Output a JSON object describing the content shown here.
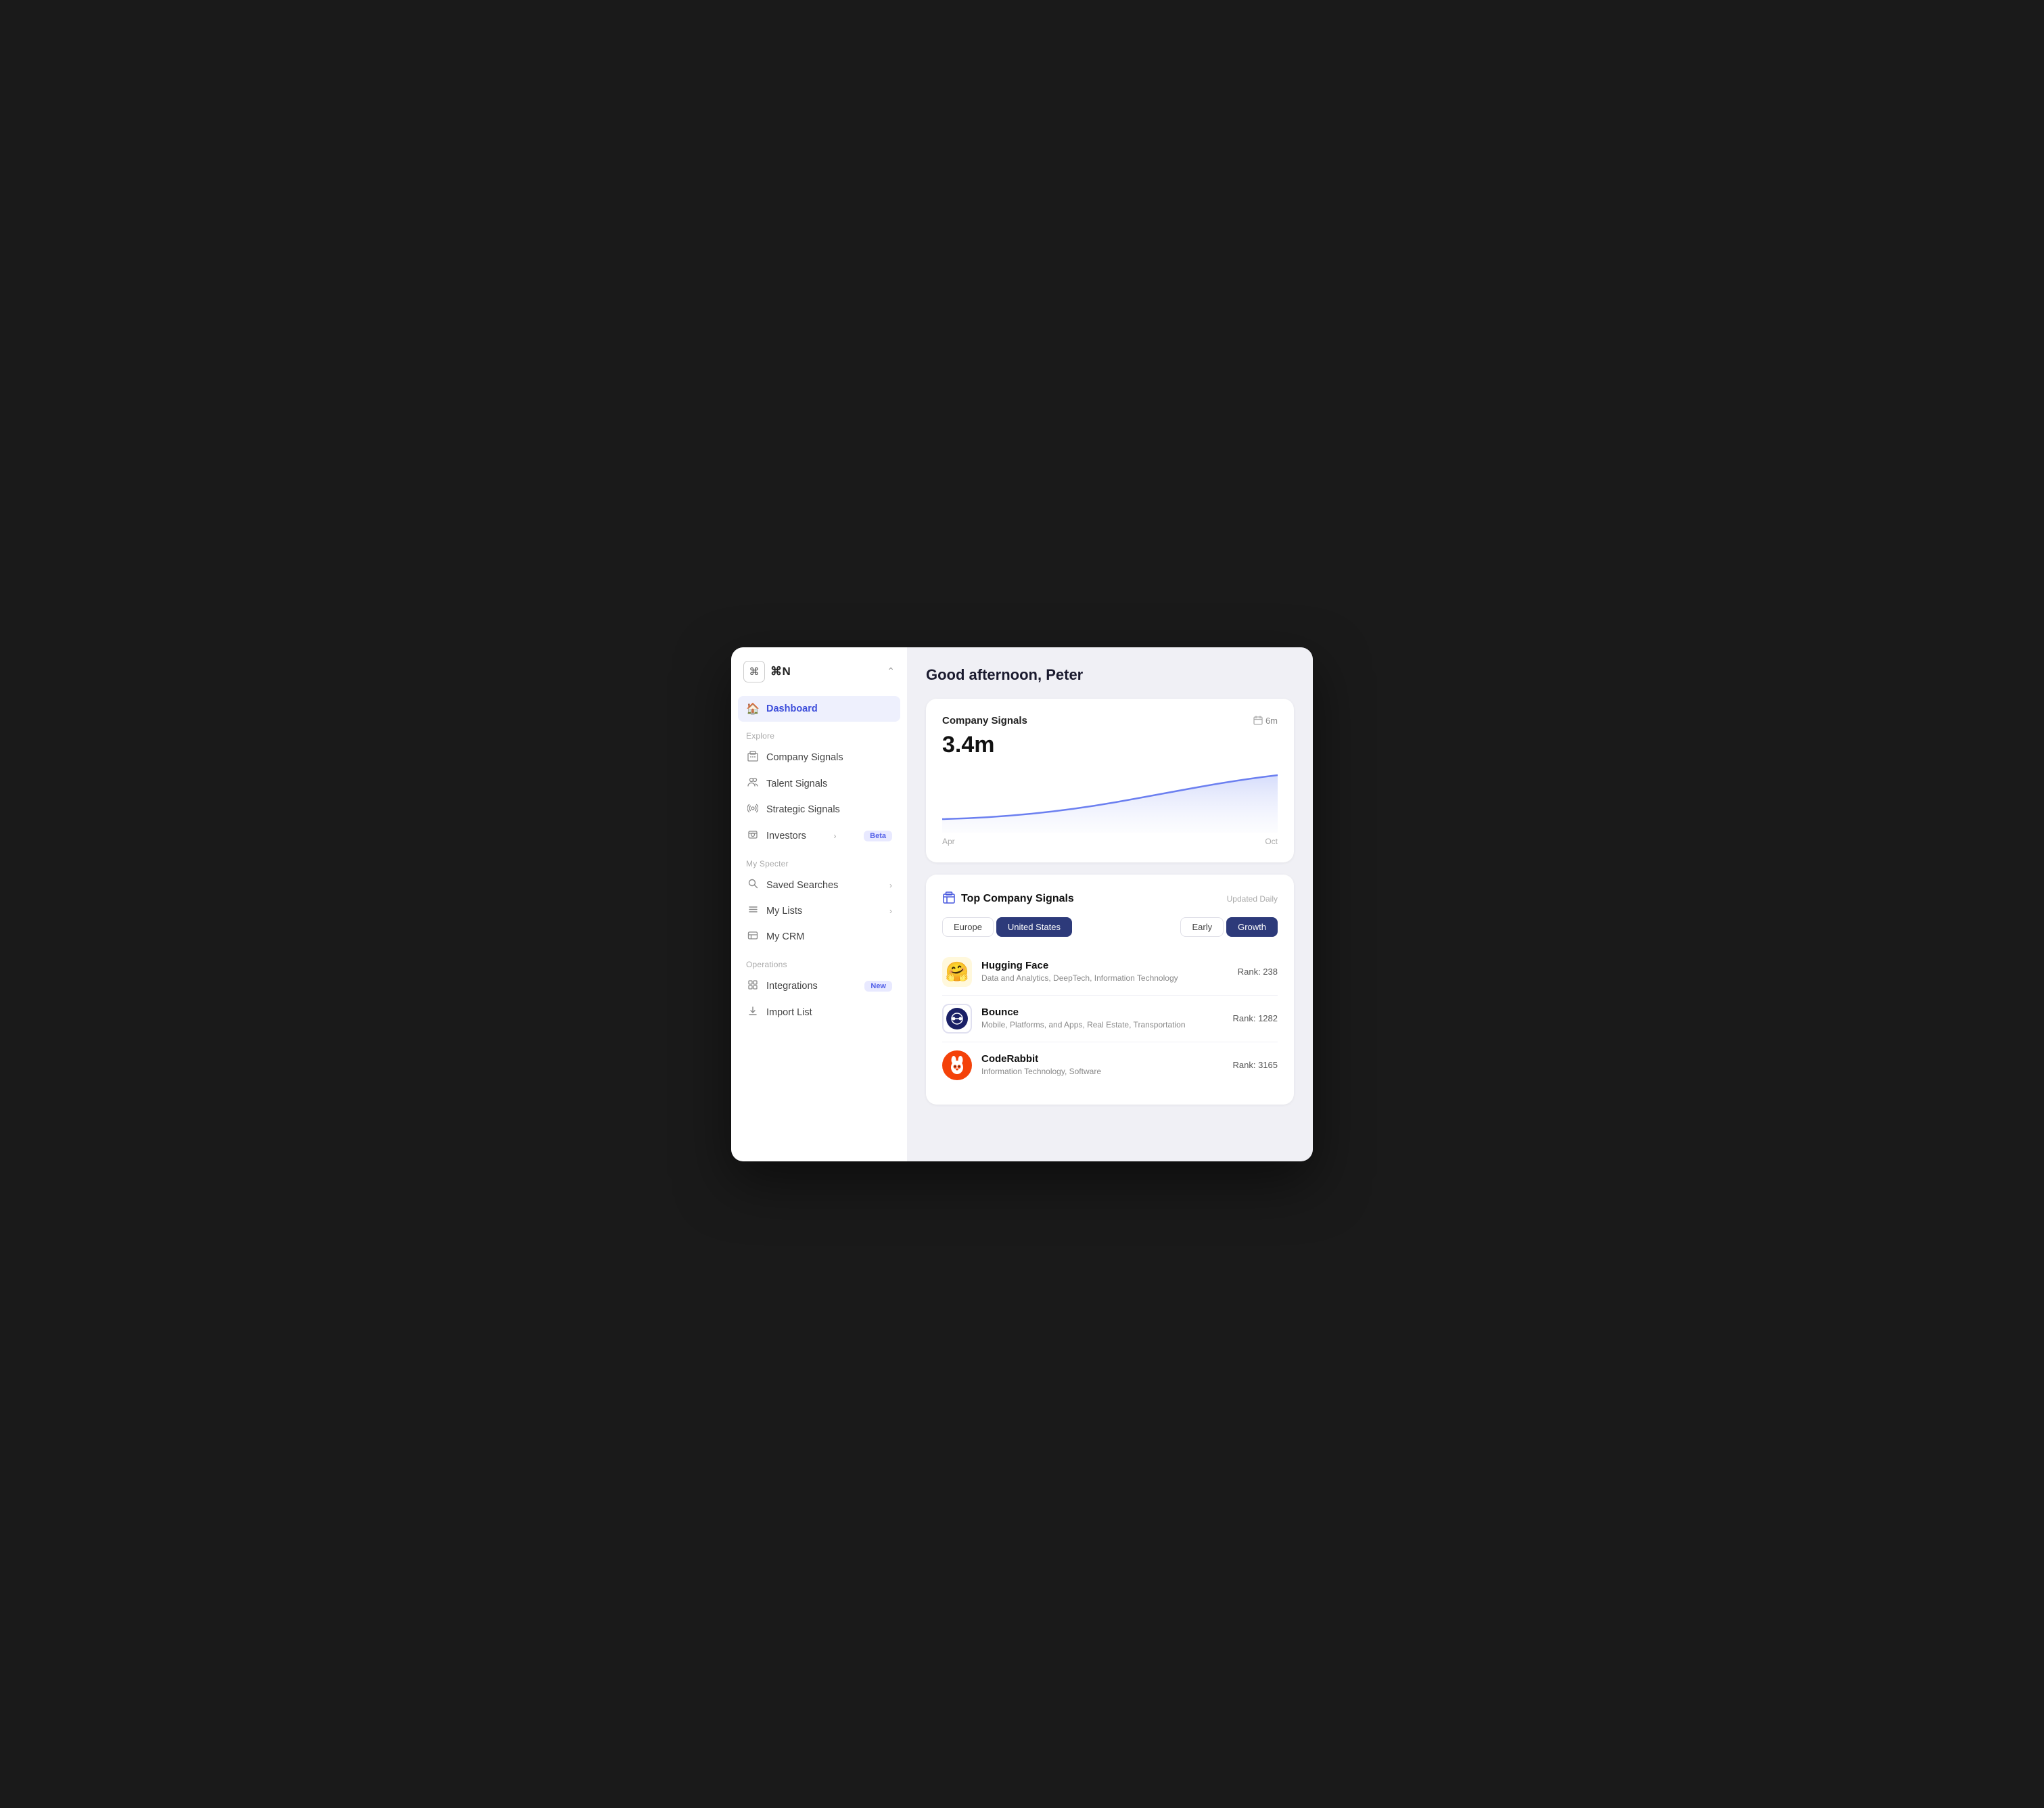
{
  "window": {
    "logo_symbol": "⌘",
    "logo_text": "⌘N",
    "chevron": "⌃"
  },
  "greeting": "Good afternoon, Peter",
  "sidebar": {
    "explore_label": "Explore",
    "my_specter_label": "My Specter",
    "operations_label": "Operations",
    "items": [
      {
        "id": "dashboard",
        "label": "Dashboard",
        "icon": "🏠",
        "active": true
      },
      {
        "id": "company-signals",
        "label": "Company Signals",
        "icon": "🏢",
        "active": false
      },
      {
        "id": "talent-signals",
        "label": "Talent Signals",
        "icon": "👥",
        "active": false
      },
      {
        "id": "strategic-signals",
        "label": "Strategic Signals",
        "icon": "📡",
        "active": false
      },
      {
        "id": "investors",
        "label": "Investors",
        "icon": "💹",
        "active": false,
        "badge": "Beta",
        "chevron": true
      },
      {
        "id": "saved-searches",
        "label": "Saved Searches",
        "icon": "🔍",
        "active": false,
        "chevron": true
      },
      {
        "id": "my-lists",
        "label": "My Lists",
        "icon": "☰",
        "active": false,
        "chevron": true
      },
      {
        "id": "my-crm",
        "label": "My CRM",
        "icon": "🏢",
        "active": false
      },
      {
        "id": "integrations",
        "label": "Integrations",
        "icon": "◻",
        "active": false,
        "badge": "New"
      },
      {
        "id": "import-list",
        "label": "Import List",
        "icon": "⬆",
        "active": false
      }
    ]
  },
  "signals_card": {
    "title": "Company Signals",
    "period": "6m",
    "value": "3.4m",
    "x_start": "Apr",
    "x_end": "Oct"
  },
  "top_signals_card": {
    "title": "Top Company Signals",
    "updated": "Updated Daily",
    "region_filters": [
      {
        "id": "europe",
        "label": "Europe",
        "active": false
      },
      {
        "id": "united-states",
        "label": "United States",
        "active": true
      }
    ],
    "stage_filters": [
      {
        "id": "early",
        "label": "Early",
        "active": false
      },
      {
        "id": "growth",
        "label": "Growth",
        "active": true
      }
    ],
    "companies": [
      {
        "name": "Hugging Face",
        "tags": "Data and Analytics, DeepTech, Information Technology",
        "rank": "Rank: 238",
        "emoji": "🤗",
        "bg": "#ffd700"
      },
      {
        "name": "Bounce",
        "tags": "Mobile, Platforms, and Apps, Real Estate, Transportation",
        "rank": "Rank: 1282",
        "emoji": "🔵",
        "bg": "#ffffff",
        "logo_type": "circle_blue"
      },
      {
        "name": "CodeRabbit",
        "tags": "Information Technology, Software",
        "rank": "Rank: 3165",
        "emoji": "🐇",
        "bg": "#ff5722",
        "logo_type": "rabbit_orange"
      }
    ]
  }
}
